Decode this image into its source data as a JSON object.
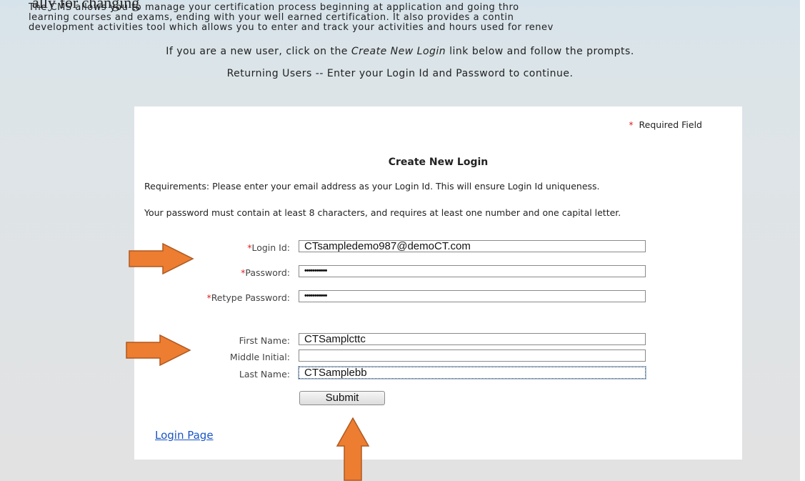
{
  "header": {
    "clipped_title": "ally for changing",
    "intro_lines": [
      "The CMS allows you to manage your certification process beginning at application and going thro",
      "learning courses and exams, ending with your well earned certification. It also provides a contin",
      "development activities tool which allows you to enter and track your activities and hours used for renev"
    ],
    "new_user_prefix": "If you are a new user, click on the ",
    "new_user_link": "Create New Login",
    "new_user_suffix": " link below and follow the prompts.",
    "returning": "Returning Users -- Enter your Login Id and Password to continue."
  },
  "form": {
    "required_marker": "*",
    "required_note": "Required Field",
    "title": "Create New Login",
    "requirements": "Requirements: Please enter your email address as your Login Id. This will ensure Login Id uniqueness.",
    "password_rule": "Your password must contain at least 8 characters, and requires at least one number and one capital letter.",
    "login_id_label": "Login Id:",
    "login_id_value": "CTsampledemo987@demoCT.com",
    "password_label": "Password:",
    "password_value": "•••••••••••",
    "retype_label": "Retype Password:",
    "retype_value": "•••••••••••",
    "first_name_label": "First Name:",
    "first_name_value": "CTSamplcttc",
    "middle_initial_label": "Middle Initial:",
    "middle_initial_value": "",
    "last_name_label": "Last Name:",
    "last_name_value": "CTSamplebb",
    "submit_label": "Submit",
    "login_page_link": "Login Page"
  },
  "colors": {
    "arrow": "#ed7d31",
    "arrow_border": "#ae5a21",
    "required": "#e02020",
    "link": "#1a55c4"
  }
}
